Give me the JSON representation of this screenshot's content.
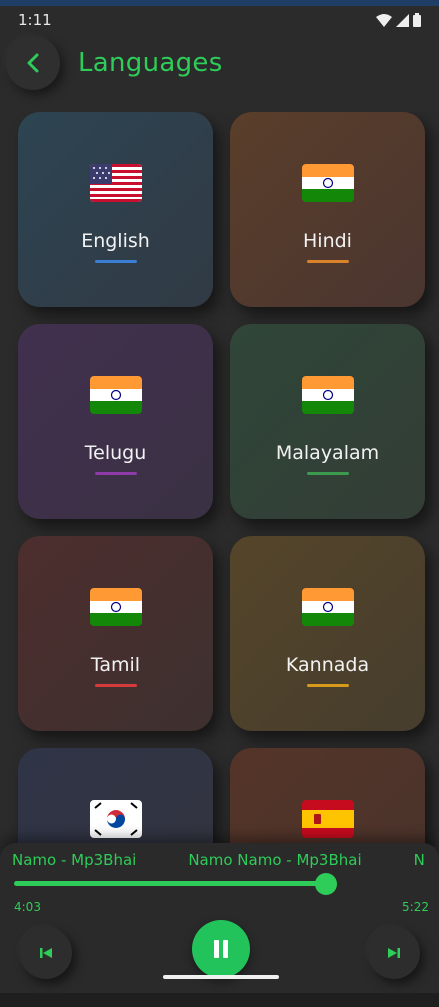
{
  "status": {
    "time": "1:11"
  },
  "header": {
    "title": "Languages"
  },
  "languages": [
    {
      "name": "English",
      "flag": "flag-us-icon",
      "accent": "#3b7fd4"
    },
    {
      "name": "Hindi",
      "flag": "flag-india-icon",
      "accent": "#d9822b"
    },
    {
      "name": "Telugu",
      "flag": "flag-india-icon",
      "accent": "#8e3aa8"
    },
    {
      "name": "Malayalam",
      "flag": "flag-india-icon",
      "accent": "#3c9a4f"
    },
    {
      "name": "Tamil",
      "flag": "flag-india-icon",
      "accent": "#d43b3b"
    },
    {
      "name": "Kannada",
      "flag": "flag-india-icon",
      "accent": "#d79a1c"
    },
    {
      "name": "",
      "flag": "flag-south-korea-icon",
      "accent": ""
    },
    {
      "name": "",
      "flag": "flag-spain-icon",
      "accent": ""
    }
  ],
  "player": {
    "title": "Namo Namo - Mp3Bhai",
    "scrolling_text_1": "Namo - Mp3Bhai",
    "scrolling_text_2": "Namo Namo - Mp3Bhai",
    "scrolling_text_3": "N",
    "elapsed": "4:03",
    "duration": "5:22",
    "progress_fraction": 0.77,
    "accent": "#2ecc58"
  }
}
